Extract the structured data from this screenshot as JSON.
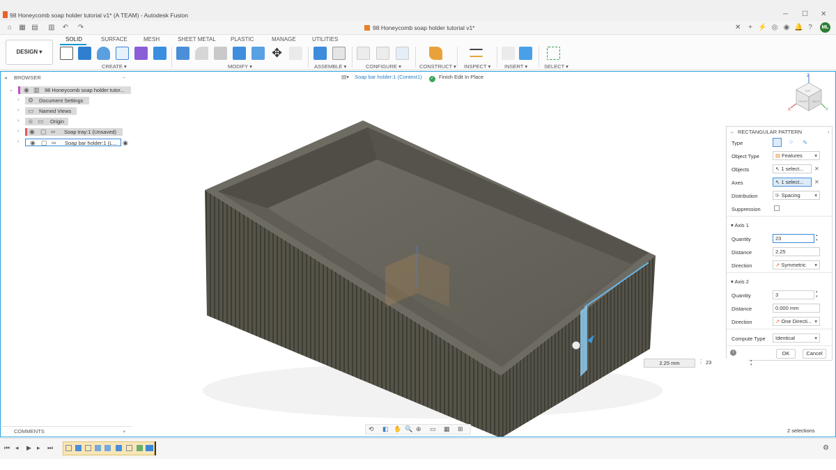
{
  "window": {
    "title": "98 Honeycomb soap holder tutorial v1* (A TEAM) - Autodesk Fusion",
    "minimize": "─",
    "maximize": "☐",
    "close": "✕"
  },
  "tabs": {
    "active_doc": "98 Honeycomb soap holder tutorial v1*",
    "close": "✕",
    "user_initials": "ML"
  },
  "toolbar": {
    "workspace_button": "DESIGN ▾",
    "workspace_tabs": [
      "SOLID",
      "SURFACE",
      "MESH",
      "SHEET METAL",
      "PLASTIC",
      "MANAGE",
      "UTILITIES"
    ],
    "groups": [
      "CREATE ▾",
      "MODIFY ▾",
      "ASSEMBLE ▾",
      "CONFIGURE ▾",
      "CONSTRUCT ▾",
      "INSPECT ▾",
      "INSERT ▾",
      "SELECT ▾"
    ]
  },
  "browser": {
    "header": "BROWSER",
    "root": "98 Honeycomb soap holder tutor...",
    "items": [
      "Document Settings",
      "Named Views",
      "Origin",
      "Soap tray:1 (Unsaved)",
      "Soap bar holder:1 (L..."
    ]
  },
  "context": {
    "component": "Soap bar holder:1 (Context1)",
    "finish": "Finish Edit In Place"
  },
  "pattern": {
    "title": "RECTANGULAR PATTERN",
    "type_label": "Type",
    "object_type_label": "Object Type",
    "object_type_value": "Features",
    "objects_label": "Objects",
    "objects_value": "1 select...",
    "axes_label": "Axes",
    "axes_value": "1 select...",
    "distribution_label": "Distribution",
    "distribution_value": "Spacing",
    "suppression_label": "Suppression",
    "axis1": {
      "heading": "Axis 1",
      "quantity_label": "Quantity",
      "quantity_value": "23",
      "distance_label": "Distance",
      "distance_value": "2.25",
      "direction_label": "Direction",
      "direction_value": "Symmetric"
    },
    "axis2": {
      "heading": "Axis 2",
      "quantity_label": "Quantity",
      "quantity_value": "3",
      "distance_label": "Distance",
      "distance_value": "0.000 mm",
      "direction_label": "Direction",
      "direction_value": "One Directi..."
    },
    "compute_label": "Compute Type",
    "compute_value": "Identical",
    "ok": "OK",
    "cancel": "Cancel"
  },
  "headsup": {
    "distance": "2.25 mm",
    "quantity": "23"
  },
  "comments": "COMMENTS",
  "status": "2 selections",
  "viewcube": {
    "top": "TOP",
    "front": "FRONT",
    "back": "BACK",
    "x": "X",
    "y": "Y",
    "z": "Z"
  },
  "colors": {
    "accent": "#0696d7",
    "model": "#5c5a52"
  }
}
